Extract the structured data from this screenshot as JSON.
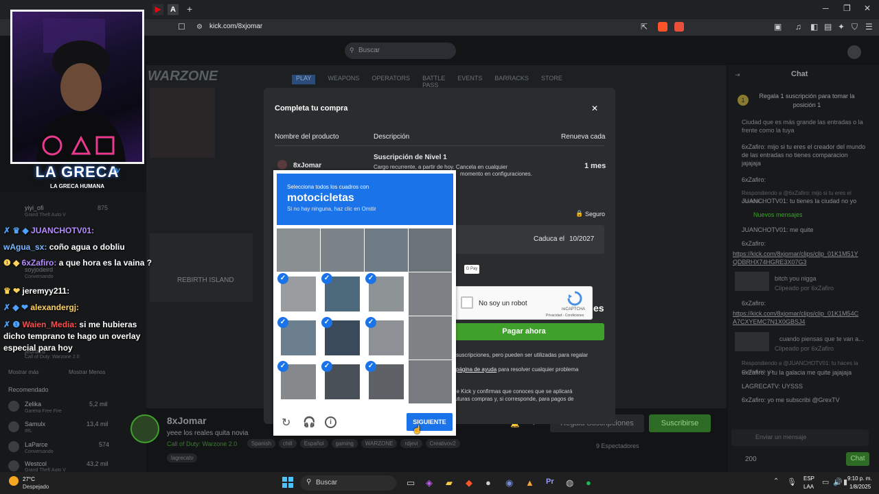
{
  "browser": {
    "url": "kick.com/8xjomar",
    "tab_glyph_1": "▶",
    "tab_glyph_2": "A",
    "new_tab": "+",
    "win_min": "─",
    "win_max": "❐",
    "win_close": "✕"
  },
  "kick": {
    "search_placeholder": "Buscar",
    "chat_title": "Chat",
    "chat_pinned": "Regala 1 suscripción para tomar la posición 1",
    "chat_lines": [
      "Ciudad que es más grande las entradas o la frente como la tuya",
      "6xZafiro: mijo si tu eres el creador del mundo de las entradas no tienes comparacion jajajaja",
      "6xZafiro:",
      "Respondiendo a @6xZafiro: mijo si tu eres el creador...",
      "JUANCHOTV01: tu tienes la ciudad no yo"
    ],
    "chat_new": "Nuevos mensajes",
    "chat_lines2": [
      "JUANCHOTV01: me quite",
      "6xZafiro:",
      "https://kick.com/8xjomar/clips/clip_01K1M51YQDBRHX74HGRE3X07G3",
      "bitch you nigga",
      "Clipeado por 6xZafiro",
      "6xZafiro:",
      "https://kick.com/8xjomar/clips/clip_01K1M54CA7CXYEMC7N1X0GBSJ4",
      "cuando piensas que te van a...",
      "Clipeado por 6xZafiro",
      "Respondiendo a @JUANCHOTV01: tu haces la ciudad no yo",
      "6xZafiro: y tu la galacia me quite jajajaja",
      "LAGRECATV: UYSSS",
      "6xZafiro: yo me subscribi @GrexTV"
    ],
    "chat_placeholder": "Enviar un mensaje",
    "points": "200",
    "chat_btn": "Chat",
    "streamer": "8xJomar",
    "stream_title": "yeee los reales quita novia",
    "category": "Call of Duty: Warzone 2.0",
    "tags": [
      "Spanish",
      "chill",
      "Español",
      "gaming",
      "WARZONE",
      "rdjevi",
      "Creativov2"
    ],
    "tag2": "lagrecatv",
    "viewers": "9 Espectadores",
    "gift_btn": "Regala Suscripciones",
    "sub_btn": "Suscribirse",
    "sidebar": [
      {
        "name": "yiyi_ofi",
        "cat": "Grand Theft Auto V",
        "count": "875"
      },
      {
        "name": "soyjodeird",
        "cat": "Conversando",
        "count": ""
      },
      {
        "name": "jeorb26",
        "cat": "Call of Duty: Warzone 2.0",
        "count": "8"
      }
    ],
    "show_more": "Mostrar más",
    "show_less": "Mostrar Menos",
    "recommended": "Recomendado",
    "recs": [
      {
        "name": "Zelika",
        "cat": "Garena Free Fire",
        "count": "5,2 mil"
      },
      {
        "name": "Samulx",
        "cat": "IRL",
        "count": "13,4 mil"
      },
      {
        "name": "LaParce",
        "cat": "Conversando",
        "count": "574"
      },
      {
        "name": "Westcol",
        "cat": "Grand Theft Auto V",
        "count": "43,2 mil"
      }
    ],
    "game_nav": [
      "PLAY",
      "WEAPONS",
      "OPERATORS",
      "BATTLE PASS",
      "EVENTS",
      "BARRACKS",
      "STORE"
    ],
    "game_title": "WARZONE",
    "game_map": "REBIRTH ISLAND"
  },
  "overlay": {
    "logo": "LA GRECA",
    "logo_tv": "TV",
    "logo_sub": "LA GRECA HUMANA",
    "lines": [
      {
        "user": "JUANCHOTV01:",
        "text": "",
        "color": "#b68cff"
      },
      {
        "user": "wAgua_sx:",
        "text": "coño agua o dobliu",
        "color": "#7fb7ff"
      },
      {
        "user": "6xZafiro:",
        "text": "a que hora es la vaina ?",
        "color": "#b68cff"
      },
      {
        "user": "jeremyy211:",
        "text": "",
        "color": "#ffffff"
      },
      {
        "user": "alexandergj:",
        "text": "",
        "color": "#ffd35a"
      },
      {
        "user": "Waien_Media:",
        "text": "si me hubieras dicho temprano te hago un overlay especial para hoy",
        "color": "#ff4d4d"
      }
    ]
  },
  "modal": {
    "title": "Completa tu compra",
    "close": "✕",
    "col_product": "Nombre del producto",
    "col_desc": "Descripción",
    "col_renew": "Renueva cada",
    "product": "8xJomar",
    "sub_name": "Suscripción de Nivel 1",
    "sub_desc": "Cargo recurrente, a partir de hoy. Cancela en cualquier",
    "sub_desc2": "momento en configuraciones.",
    "period": "1 mes",
    "secure": "Seguro",
    "expires_label": "Caduca el",
    "expires_val": "10/2027",
    "gpay": "G Pay",
    "total_suffix": "es",
    "pay_btn": "Pagar ahora",
    "note1": "suscripciones, pero pueden ser utilizadas para regalar",
    "note2_link": "página de ayuda",
    "note2": "para resolver cualquier problema",
    "note3": "de Kick y confirmas que conoces que se aplicará",
    "note4": "futuras compras y, si corresponde, para pagos de"
  },
  "recaptcha": {
    "label": "No soy un robot",
    "brand": "reCAPTCHA",
    "links": "Privacidad - Condiciones"
  },
  "captcha": {
    "instr": "Selecciona todos los cuadros con",
    "target": "motocicletas",
    "hint": "Si no hay ninguna, haz clic en Omitir",
    "next": "SIGUIENTE",
    "selected": [
      false,
      false,
      false,
      false,
      true,
      true,
      true,
      false,
      true,
      true,
      true,
      false,
      true,
      true,
      true,
      false
    ]
  },
  "taskbar": {
    "temp": "27°C",
    "weather": "Despejado",
    "search": "Buscar",
    "lang1": "ESP",
    "lang2": "LAA",
    "time": "9:10 p. m.",
    "date": "1/8/2025"
  }
}
